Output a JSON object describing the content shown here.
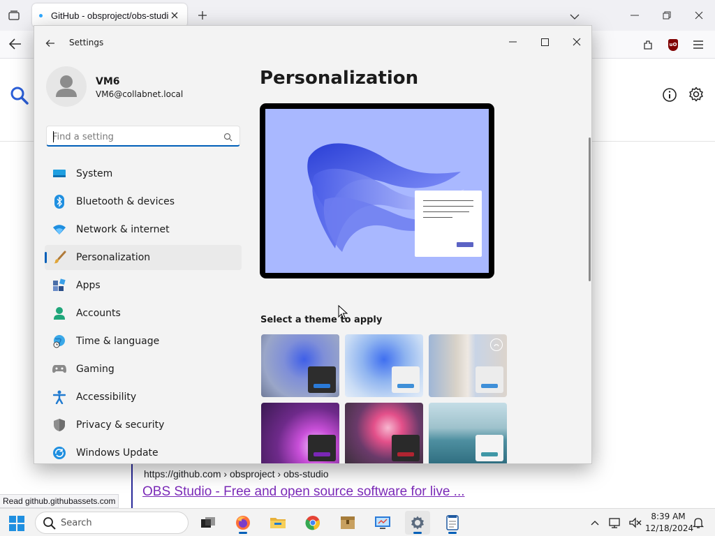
{
  "browser": {
    "tab_title": "GitHub - obsproject/obs-studio",
    "result_url": "https://github.com  › obsproject › obs-studio",
    "result_title": "OBS Studio - Free and open source software for live ...",
    "status_text": "Read github.githubassets.com"
  },
  "settings": {
    "window_title": "Settings",
    "user": {
      "name": "VM6",
      "email": "VM6@collabnet.local"
    },
    "search_placeholder": "Find a setting",
    "nav": [
      {
        "label": "System",
        "icon": "system-icon"
      },
      {
        "label": "Bluetooth & devices",
        "icon": "bluetooth-icon"
      },
      {
        "label": "Network & internet",
        "icon": "network-icon"
      },
      {
        "label": "Personalization",
        "icon": "paintbrush-icon",
        "selected": true
      },
      {
        "label": "Apps",
        "icon": "apps-icon"
      },
      {
        "label": "Accounts",
        "icon": "accounts-icon"
      },
      {
        "label": "Time & language",
        "icon": "globe-clock-icon"
      },
      {
        "label": "Gaming",
        "icon": "gamepad-icon"
      },
      {
        "label": "Accessibility",
        "icon": "accessibility-icon"
      },
      {
        "label": "Privacy & security",
        "icon": "shield-icon"
      },
      {
        "label": "Windows Update",
        "icon": "update-icon"
      }
    ],
    "page_title": "Personalization",
    "theme_section_label": "Select a theme to apply",
    "themes": [
      {
        "name": "windows-dark-theme",
        "accent": "#2a7ad8"
      },
      {
        "name": "windows-light-theme",
        "accent": "#3f8fd8"
      },
      {
        "name": "windows-spotlight-theme",
        "accent": "#3f8fd8"
      },
      {
        "name": "glow-theme",
        "accent": "#7a27b6"
      },
      {
        "name": "captured-motion-theme",
        "accent": "#b02431"
      },
      {
        "name": "flow-theme",
        "accent": "#3f97a6"
      }
    ]
  },
  "taskbar": {
    "search_label": "Search",
    "time": "8:39 AM",
    "date": "12/18/2024"
  },
  "colors": {
    "accent": "#005fb8",
    "link_visited": "#7b2ab8",
    "preview_bg": "#a9b8ff"
  }
}
